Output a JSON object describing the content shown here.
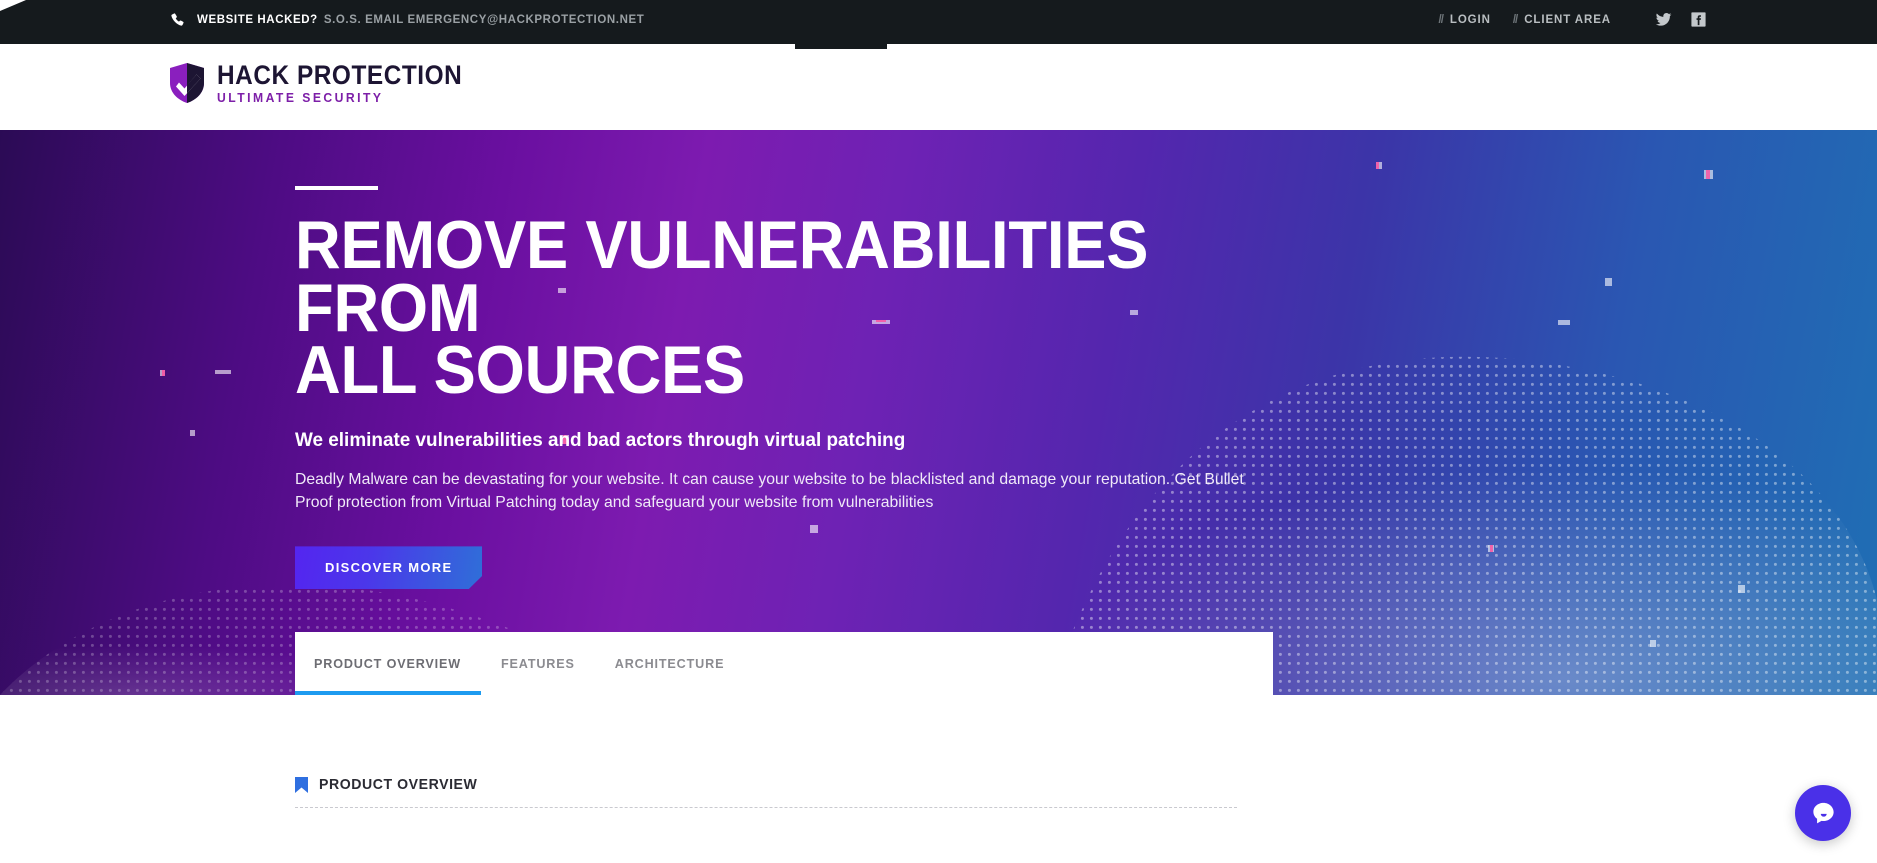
{
  "topbar": {
    "sos_strong": "WEBSITE HACKED?",
    "sos_rest": "S.O.S. EMAIL EMERGENCY@HACKPROTECTION.NET",
    "phone_icon": "phone-icon",
    "links": [
      {
        "slashes": "//",
        "label": "LOGIN"
      },
      {
        "slashes": "//",
        "label": "CLIENT AREA"
      }
    ],
    "social": [
      {
        "icon": "twitter-icon",
        "name": "Twitter"
      },
      {
        "icon": "facebook-icon",
        "name": "Facebook"
      }
    ]
  },
  "header": {
    "logo_icon": "shield-check-icon",
    "logo_main": "HACK PROTECTION",
    "logo_sub": "ULTIMATE SECURITY"
  },
  "hero": {
    "title": "REMOVE VULNERABILITIES FROM\nALL SOURCES",
    "subtitle": "We eliminate vulnerabilities and bad actors through virtual patching",
    "paragraph": "Deadly Malware can be devastating for your website. It can cause your website to be blacklisted and damage your reputation. Get Bullet Proof protection from Virtual Patching today and safeguard your website from vulnerabilities",
    "cta_label": "DISCOVER MORE",
    "gradient_start": "#2b0b55",
    "gradient_mid": "#7d1bb0",
    "gradient_end": "#1f6fb4"
  },
  "tabs": [
    {
      "label": "PRODUCT OVERVIEW",
      "active": true
    },
    {
      "label": "FEATURES",
      "active": false
    },
    {
      "label": "ARCHITECTURE",
      "active": false
    }
  ],
  "tab_accent_color": "#1d9bf0",
  "section": {
    "flag_icon": "flag-icon",
    "title": "PRODUCT OVERVIEW"
  },
  "chat": {
    "icon": "chat-bubble-icon",
    "color": "#4a30e8"
  }
}
